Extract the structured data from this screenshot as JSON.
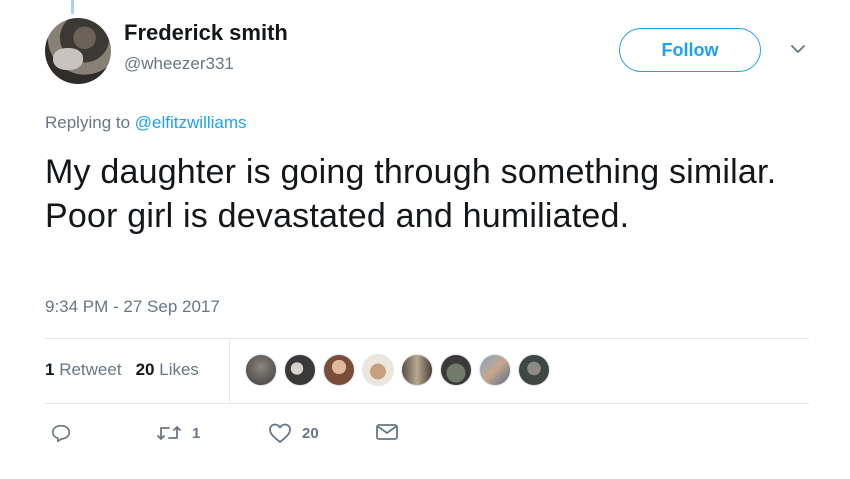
{
  "author": {
    "name": "Frederick smith",
    "handle": "@wheezer331"
  },
  "follow_label": "Follow",
  "reply_context": {
    "prefix": "Replying to",
    "mention": "@elfitzwilliams"
  },
  "tweet_text": "My daughter is going through something similar. Poor girl is devastated and humiliated.",
  "timestamp": "9:34 PM - 27 Sep 2017",
  "stats": {
    "retweet_count": "1",
    "retweet_label": "Retweet",
    "likes_count": "20",
    "likes_label": "Likes"
  },
  "actions": {
    "retweet_count": "1",
    "like_count": "20"
  },
  "colors": {
    "accent": "#1da1f2",
    "muted_text": "#657786",
    "primary_text": "#14171a",
    "divider": "#e1e8ed"
  },
  "icons": [
    "caret-down-icon",
    "reply-icon",
    "retweet-icon",
    "heart-icon",
    "envelope-icon"
  ]
}
